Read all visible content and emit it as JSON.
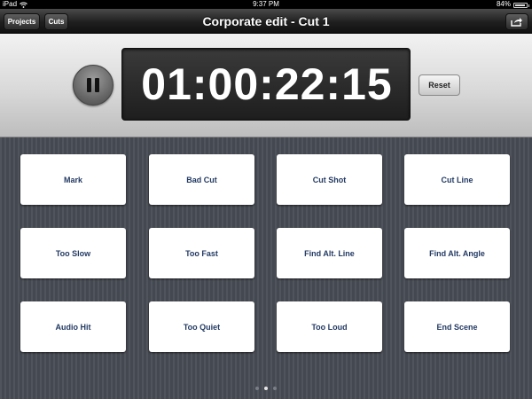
{
  "status_bar": {
    "device": "iPad",
    "time": "9:37 PM",
    "battery": "84%"
  },
  "nav": {
    "title": "Corporate edit - Cut 1",
    "projects_label": "Projects",
    "cuts_label": "Cuts",
    "share_icon": "share-icon"
  },
  "timer": {
    "display": "01:00:22:15",
    "reset_label": "Reset",
    "pause_icon": "pause-icon"
  },
  "markers": [
    {
      "label": "Mark"
    },
    {
      "label": "Bad Cut"
    },
    {
      "label": "Cut Shot"
    },
    {
      "label": "Cut Line"
    },
    {
      "label": "Too Slow"
    },
    {
      "label": "Too Fast"
    },
    {
      "label": "Find Alt. Line"
    },
    {
      "label": "Find Alt. Angle"
    },
    {
      "label": "Audio Hit"
    },
    {
      "label": "Too Quiet"
    },
    {
      "label": "Too Loud"
    },
    {
      "label": "End Scene"
    }
  ],
  "pager": {
    "pages": 3,
    "current": 2
  },
  "colors": {
    "tile_text": "#233a63",
    "background": "#474b53"
  }
}
